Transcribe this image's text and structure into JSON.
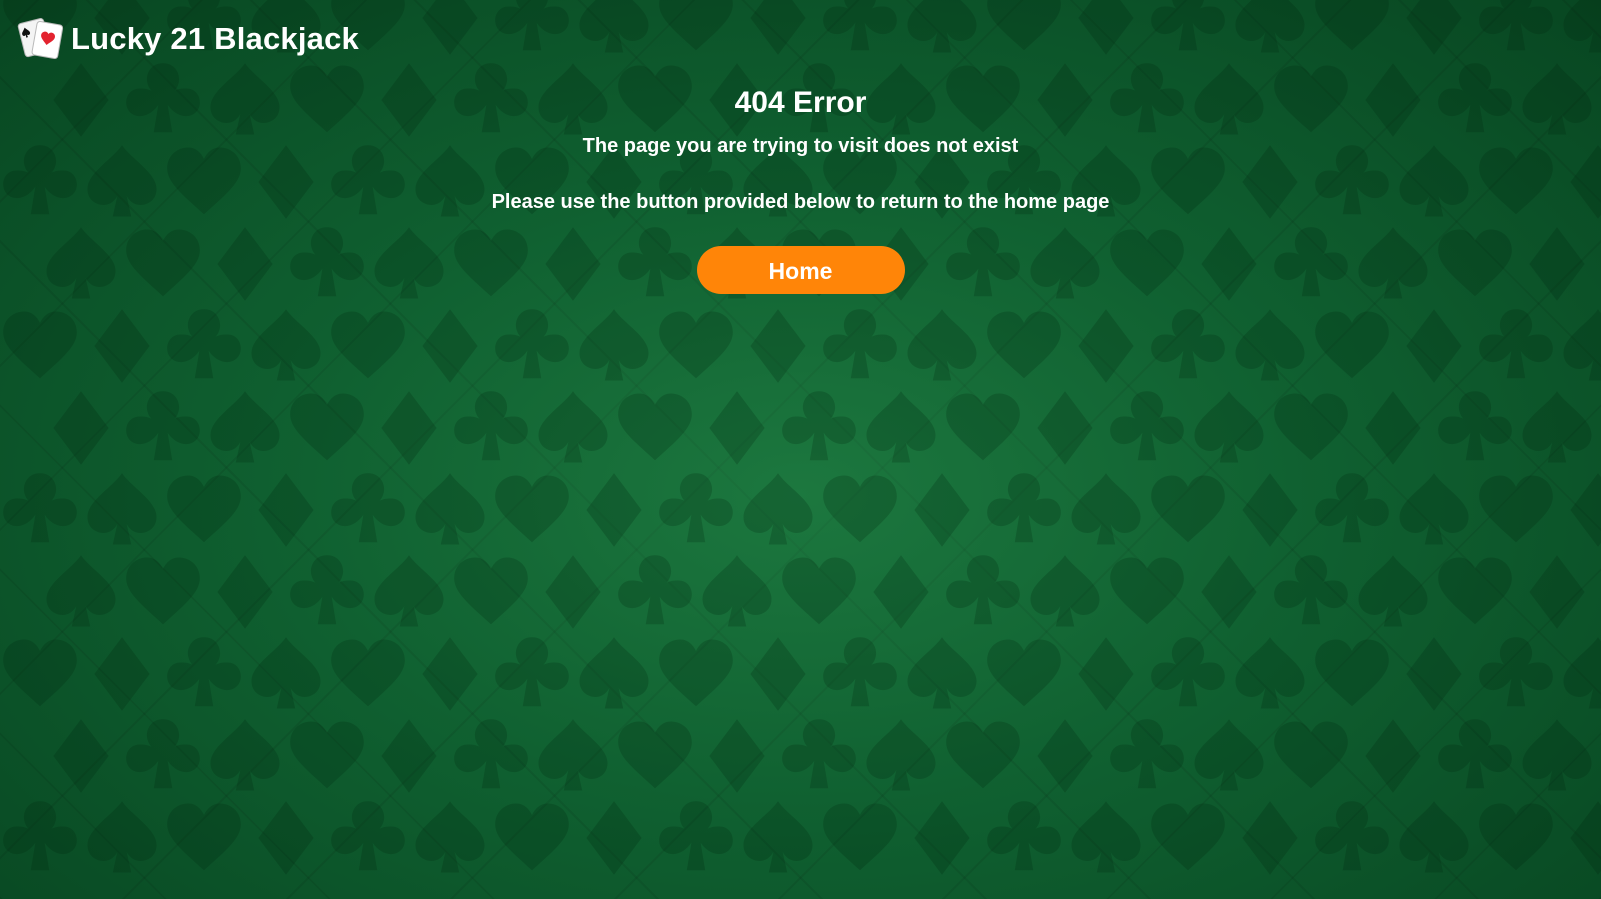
{
  "header": {
    "brand": "Lucky 21 Blackjack",
    "logo_icon": "playing-cards-icon"
  },
  "error": {
    "title": "404 Error",
    "message_line1": "The page you are trying to visit does not exist",
    "message_line2": "Please use the button provided below to return to the home page"
  },
  "actions": {
    "home_label": "Home"
  },
  "colors": {
    "felt_green": "#0e5f30",
    "button_orange": "#ff8508",
    "text": "#ffffff"
  },
  "background_icons": [
    "heart-icon",
    "diamond-icon",
    "club-icon",
    "spade-icon"
  ]
}
